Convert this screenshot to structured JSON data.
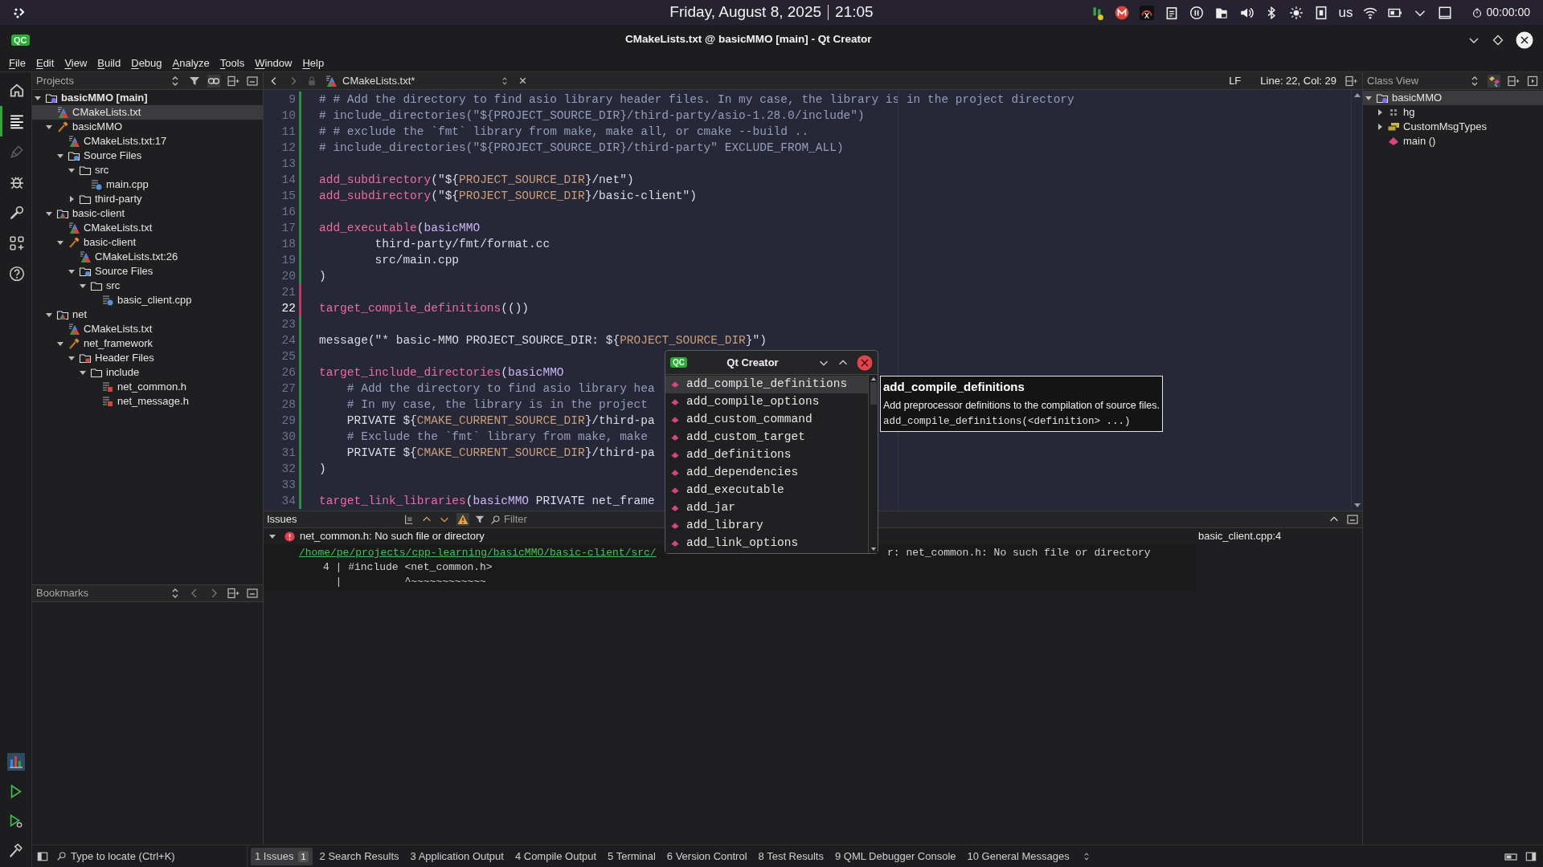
{
  "system_bar": {
    "date": "Friday, August 8, 2025",
    "time": "21:05",
    "keyboard_layout": "us",
    "timer": "00:00:00"
  },
  "window": {
    "logo": "QC",
    "title": "CMakeLists.txt @ basicMMO [main] - Qt Creator"
  },
  "menu": [
    "File",
    "Edit",
    "View",
    "Build",
    "Debug",
    "Analyze",
    "Tools",
    "Window",
    "Help"
  ],
  "modes": [
    {
      "kind": "welcome",
      "selected": false,
      "disabled": false
    },
    {
      "kind": "edit",
      "selected": true,
      "disabled": false
    },
    {
      "kind": "design",
      "selected": false,
      "disabled": true
    },
    {
      "kind": "debug",
      "selected": false,
      "disabled": false
    },
    {
      "kind": "projects",
      "selected": false,
      "disabled": false
    },
    {
      "kind": "extensions",
      "selected": false,
      "disabled": false
    },
    {
      "kind": "help",
      "selected": false,
      "disabled": false
    }
  ],
  "run_controls": [
    {
      "kind": "kit"
    },
    {
      "kind": "run"
    },
    {
      "kind": "debug_run"
    },
    {
      "kind": "build"
    }
  ],
  "projects": {
    "title": "Projects",
    "tree": [
      {
        "label": "basicMMO [main]",
        "kind": "project",
        "expanded": true,
        "selected": false,
        "children": [
          {
            "label": "CMakeLists.txt",
            "kind": "cmake_file",
            "selected": true
          },
          {
            "label": "basicMMO",
            "kind": "target",
            "expanded": true,
            "selected": false,
            "children": [
              {
                "label": "CMakeLists.txt:17",
                "kind": "cmake_file",
                "selected": false
              },
              {
                "label": "Source Files",
                "kind": "source_group",
                "expanded": true,
                "selected": false,
                "children": [
                  {
                    "label": "src",
                    "kind": "folder",
                    "expanded": true,
                    "selected": false,
                    "children": [
                      {
                        "label": "main.cpp",
                        "kind": "source",
                        "selected": false
                      }
                    ]
                  },
                  {
                    "label": "third-party",
                    "kind": "folder",
                    "expanded": false,
                    "selected": false
                  }
                ]
              }
            ]
          },
          {
            "label": "basic-client",
            "kind": "subproject",
            "expanded": true,
            "selected": false,
            "children": [
              {
                "label": "CMakeLists.txt",
                "kind": "cmake_file",
                "selected": false
              },
              {
                "label": "basic-client",
                "kind": "target",
                "expanded": true,
                "selected": false,
                "children": [
                  {
                    "label": "CMakeLists.txt:26",
                    "kind": "cmake_file",
                    "selected": false
                  },
                  {
                    "label": "Source Files",
                    "kind": "source_group",
                    "expanded": true,
                    "selected": false,
                    "children": [
                      {
                        "label": "src",
                        "kind": "folder",
                        "expanded": true,
                        "selected": false,
                        "children": [
                          {
                            "label": "basic_client.cpp",
                            "kind": "source",
                            "selected": false
                          }
                        ]
                      }
                    ]
                  }
                ]
              }
            ]
          },
          {
            "label": "net",
            "kind": "subproject",
            "expanded": true,
            "selected": false,
            "children": [
              {
                "label": "CMakeLists.txt",
                "kind": "cmake_file",
                "selected": false
              },
              {
                "label": "net_framework",
                "kind": "target",
                "expanded": true,
                "selected": false,
                "children": [
                  {
                    "label": "Header Files",
                    "kind": "header_group",
                    "expanded": true,
                    "selected": false,
                    "children": [
                      {
                        "label": "include",
                        "kind": "folder",
                        "expanded": true,
                        "selected": false,
                        "children": [
                          {
                            "label": "net_common.h",
                            "kind": "header",
                            "selected": false
                          },
                          {
                            "label": "net_message.h",
                            "kind": "header",
                            "selected": false
                          }
                        ]
                      }
                    ]
                  }
                ]
              }
            ]
          }
        ]
      }
    ]
  },
  "bookmarks": {
    "title": "Bookmarks"
  },
  "editor": {
    "tab": "CMakeLists.txt*",
    "line_ending": "LF",
    "position": "Line: 22, Col: 29",
    "lines": [
      {
        "number": "9",
        "unsaved": false,
        "current": false,
        "segments": [
          {
            "kind": "comment",
            "text": "# # Add the directory to find asio library header files. In my case, the library is in the project directory"
          }
        ]
      },
      {
        "number": "10",
        "unsaved": false,
        "current": false,
        "segments": [
          {
            "kind": "comment",
            "text": "# include_directories(\"${PROJECT_SOURCE_DIR}/third-party/asio-1.28.0/include\")"
          }
        ]
      },
      {
        "number": "11",
        "unsaved": false,
        "current": false,
        "segments": [
          {
            "kind": "comment",
            "text": "# # exclude the `fmt` library from make, make all, or cmake --build .."
          }
        ]
      },
      {
        "number": "12",
        "unsaved": false,
        "current": false,
        "segments": [
          {
            "kind": "comment",
            "text": "# include_directories(\"${PROJECT_SOURCE_DIR}/third-party\" EXCLUDE_FROM_ALL)"
          }
        ]
      },
      {
        "number": "13",
        "unsaved": false,
        "current": false
      },
      {
        "number": "14",
        "unsaved": false,
        "current": false,
        "segments": [
          {
            "kind": "func",
            "text": "add_subdirectory"
          },
          {
            "kind": "plain",
            "text": "(\"${"
          },
          {
            "kind": "var",
            "text": "PROJECT_SOURCE_DIR"
          },
          {
            "kind": "plain",
            "text": "}/net\")"
          }
        ]
      },
      {
        "number": "15",
        "unsaved": false,
        "current": false,
        "segments": [
          {
            "kind": "func",
            "text": "add_subdirectory"
          },
          {
            "kind": "plain",
            "text": "(\"${"
          },
          {
            "kind": "var",
            "text": "PROJECT_SOURCE_DIR"
          },
          {
            "kind": "plain",
            "text": "}/basic-client\")"
          }
        ]
      },
      {
        "number": "16",
        "unsaved": false,
        "current": false
      },
      {
        "number": "17",
        "unsaved": false,
        "current": false,
        "segments": [
          {
            "kind": "func",
            "text": "add_executable"
          },
          {
            "kind": "plain",
            "text": "("
          },
          {
            "kind": "arg",
            "text": "basicMMO"
          }
        ]
      },
      {
        "number": "18",
        "unsaved": false,
        "current": false,
        "segments": [
          {
            "kind": "plain",
            "text": "        third-party/fmt/format.cc"
          }
        ]
      },
      {
        "number": "19",
        "unsaved": false,
        "current": false,
        "segments": [
          {
            "kind": "plain",
            "text": "        src/main.cpp"
          }
        ]
      },
      {
        "number": "20",
        "unsaved": false,
        "current": false,
        "segments": [
          {
            "kind": "plain",
            "text": ")"
          }
        ]
      },
      {
        "number": "21",
        "unsaved": true,
        "current": false
      },
      {
        "number": "22",
        "unsaved": true,
        "current": true,
        "segments": [
          {
            "kind": "func",
            "text": "target_compile_definitions"
          },
          {
            "kind": "plain",
            "text": "(())"
          }
        ]
      },
      {
        "number": "23",
        "unsaved": false,
        "current": false
      },
      {
        "number": "24",
        "unsaved": false,
        "current": false,
        "segments": [
          {
            "kind": "plain",
            "text": "message(\"* basic-MMO PROJECT_SOURCE_DIR: ${"
          },
          {
            "kind": "var",
            "text": "PROJECT_SOURCE_DIR"
          },
          {
            "kind": "plain",
            "text": "}\")"
          }
        ]
      },
      {
        "number": "25",
        "unsaved": false,
        "current": false
      },
      {
        "number": "26",
        "unsaved": false,
        "current": false,
        "segments": [
          {
            "kind": "func",
            "text": "target_include_directories"
          },
          {
            "kind": "plain",
            "text": "("
          },
          {
            "kind": "arg",
            "text": "basicMMO"
          }
        ]
      },
      {
        "number": "27",
        "unsaved": false,
        "current": false,
        "segments": [
          {
            "kind": "comment",
            "text": "    # Add the directory to find asio library hea"
          }
        ]
      },
      {
        "number": "28",
        "unsaved": false,
        "current": false,
        "segments": [
          {
            "kind": "comment",
            "text": "    # In my case, the library is in the project"
          }
        ]
      },
      {
        "number": "29",
        "unsaved": false,
        "current": false,
        "segments": [
          {
            "kind": "plain",
            "text": "    PRIVATE ${"
          },
          {
            "kind": "var",
            "text": "CMAKE_CURRENT_SOURCE_DIR"
          },
          {
            "kind": "plain",
            "text": "}/third-pa"
          }
        ]
      },
      {
        "number": "30",
        "unsaved": false,
        "current": false,
        "segments": [
          {
            "kind": "comment",
            "text": "    # Exclude the `fmt` library from make, make"
          }
        ]
      },
      {
        "number": "31",
        "unsaved": false,
        "current": false,
        "segments": [
          {
            "kind": "plain",
            "text": "    PRIVATE ${"
          },
          {
            "kind": "var",
            "text": "CMAKE_CURRENT_SOURCE_DIR"
          },
          {
            "kind": "plain",
            "text": "}/third-pa"
          }
        ]
      },
      {
        "number": "32",
        "unsaved": false,
        "current": false,
        "segments": [
          {
            "kind": "plain",
            "text": ")"
          }
        ]
      },
      {
        "number": "33",
        "unsaved": false,
        "current": false
      },
      {
        "number": "34",
        "unsaved": false,
        "current": false,
        "segments": [
          {
            "kind": "func",
            "text": "target_link_libraries"
          },
          {
            "kind": "plain",
            "text": "("
          },
          {
            "kind": "arg",
            "text": "basicMMO"
          },
          {
            "kind": "plain",
            "text": " PRIVATE net_frame"
          }
        ]
      }
    ]
  },
  "completion": {
    "logo": "QC",
    "title": "Qt Creator",
    "items": [
      {
        "label": "add_compile_definitions",
        "selected": true
      },
      {
        "label": "add_compile_options",
        "selected": false
      },
      {
        "label": "add_custom_command",
        "selected": false
      },
      {
        "label": "add_custom_target",
        "selected": false
      },
      {
        "label": "add_definitions",
        "selected": false
      },
      {
        "label": "add_dependencies",
        "selected": false
      },
      {
        "label": "add_executable",
        "selected": false
      },
      {
        "label": "add_jar",
        "selected": false
      },
      {
        "label": "add_library",
        "selected": false
      },
      {
        "label": "add_link_options",
        "selected": false
      }
    ],
    "tooltip": {
      "title": "add_compile_definitions",
      "description": "Add preprocessor definitions to the compilation of source files.",
      "signature": "add_compile_definitions(<definition> ...)"
    }
  },
  "issues": {
    "title": "Issues",
    "filter_placeholder": "Filter",
    "items": [
      {
        "message": "net_common.h: No such file or directory",
        "location": "basic_client.cpp:4",
        "expanded": true,
        "path": "/home/pe/projects/cpp-learning/basicMMO/basic-client/src/",
        "detail": "r: net_common.h: No such file or directory",
        "source_lines": [
          "4 | #include <net_common.h>",
          "  |          ^~~~~~~~~~~~~"
        ]
      }
    ]
  },
  "class_view": {
    "title": "Class View",
    "tree": [
      {
        "label": "basicMMO",
        "kind": "project",
        "expanded": true,
        "selected": true,
        "children": [
          {
            "label": "hg",
            "kind": "namespace",
            "expanded": false,
            "selected": false
          },
          {
            "label": "CustomMsgTypes",
            "kind": "enum",
            "expanded": false,
            "selected": false
          },
          {
            "label": "main ()",
            "kind": "function",
            "selected": false
          }
        ]
      }
    ]
  },
  "status_bar": {
    "locator_placeholder": "Type to locate (Ctrl+K)",
    "panes": [
      {
        "number": "1",
        "label": "Issues",
        "badge": "1",
        "selected": true
      },
      {
        "number": "2",
        "label": "Search Results",
        "selected": false
      },
      {
        "number": "3",
        "label": "Application Output",
        "selected": false
      },
      {
        "number": "4",
        "label": "Compile Output",
        "selected": false
      },
      {
        "number": "5",
        "label": "Terminal",
        "selected": false
      },
      {
        "number": "6",
        "label": "Version Control",
        "selected": false
      },
      {
        "number": "8",
        "label": "Test Results",
        "selected": false
      },
      {
        "number": "9",
        "label": "QML Debugger Console",
        "selected": false
      },
      {
        "number": "10",
        "label": "General Messages",
        "selected": false
      }
    ]
  }
}
